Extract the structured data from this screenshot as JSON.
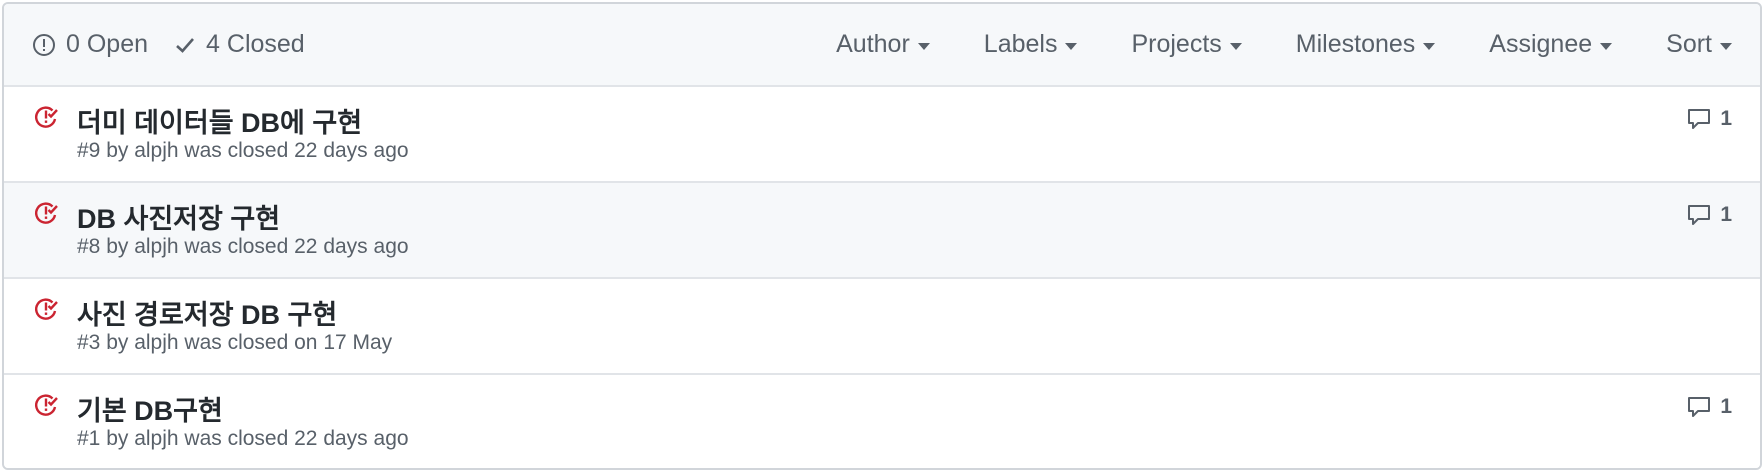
{
  "states": {
    "open": {
      "count": "0",
      "label": "Open"
    },
    "closed": {
      "count": "4",
      "label": "Closed"
    }
  },
  "filters": [
    "Author",
    "Labels",
    "Projects",
    "Milestones",
    "Assignee",
    "Sort"
  ],
  "colors": {
    "closed_icon": "#cb2431",
    "muted": "#586069",
    "header_bg": "#f6f8fa"
  },
  "issues": [
    {
      "title": "더미 데이터들 DB에 구현",
      "meta": "#9 by alpjh was closed 22 days ago",
      "comments": "1",
      "icon": "issue-closed-icon"
    },
    {
      "title": "DB 사진저장 구현",
      "meta": "#8 by alpjh was closed 22 days ago",
      "comments": "1",
      "icon": "issue-closed-icon"
    },
    {
      "title": "사진 경로저장 DB 구현",
      "meta": "#3 by alpjh was closed on 17 May",
      "comments": "",
      "icon": "issue-closed-icon"
    },
    {
      "title": "기본 DB구현",
      "meta": "#1 by alpjh was closed 22 days ago",
      "comments": "1",
      "icon": "issue-closed-icon"
    }
  ]
}
